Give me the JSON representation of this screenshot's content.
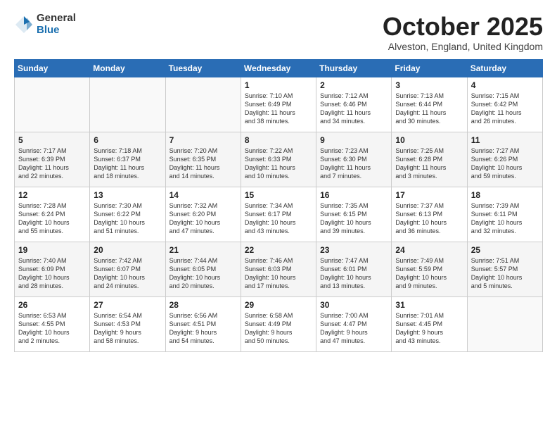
{
  "logo": {
    "general": "General",
    "blue": "Blue"
  },
  "title": "October 2025",
  "location": "Alveston, England, United Kingdom",
  "weekdays": [
    "Sunday",
    "Monday",
    "Tuesday",
    "Wednesday",
    "Thursday",
    "Friday",
    "Saturday"
  ],
  "weeks": [
    [
      {
        "date": "",
        "info": ""
      },
      {
        "date": "",
        "info": ""
      },
      {
        "date": "",
        "info": ""
      },
      {
        "date": "1",
        "info": "Sunrise: 7:10 AM\nSunset: 6:49 PM\nDaylight: 11 hours\nand 38 minutes."
      },
      {
        "date": "2",
        "info": "Sunrise: 7:12 AM\nSunset: 6:46 PM\nDaylight: 11 hours\nand 34 minutes."
      },
      {
        "date": "3",
        "info": "Sunrise: 7:13 AM\nSunset: 6:44 PM\nDaylight: 11 hours\nand 30 minutes."
      },
      {
        "date": "4",
        "info": "Sunrise: 7:15 AM\nSunset: 6:42 PM\nDaylight: 11 hours\nand 26 minutes."
      }
    ],
    [
      {
        "date": "5",
        "info": "Sunrise: 7:17 AM\nSunset: 6:39 PM\nDaylight: 11 hours\nand 22 minutes."
      },
      {
        "date": "6",
        "info": "Sunrise: 7:18 AM\nSunset: 6:37 PM\nDaylight: 11 hours\nand 18 minutes."
      },
      {
        "date": "7",
        "info": "Sunrise: 7:20 AM\nSunset: 6:35 PM\nDaylight: 11 hours\nand 14 minutes."
      },
      {
        "date": "8",
        "info": "Sunrise: 7:22 AM\nSunset: 6:33 PM\nDaylight: 11 hours\nand 10 minutes."
      },
      {
        "date": "9",
        "info": "Sunrise: 7:23 AM\nSunset: 6:30 PM\nDaylight: 11 hours\nand 7 minutes."
      },
      {
        "date": "10",
        "info": "Sunrise: 7:25 AM\nSunset: 6:28 PM\nDaylight: 11 hours\nand 3 minutes."
      },
      {
        "date": "11",
        "info": "Sunrise: 7:27 AM\nSunset: 6:26 PM\nDaylight: 10 hours\nand 59 minutes."
      }
    ],
    [
      {
        "date": "12",
        "info": "Sunrise: 7:28 AM\nSunset: 6:24 PM\nDaylight: 10 hours\nand 55 minutes."
      },
      {
        "date": "13",
        "info": "Sunrise: 7:30 AM\nSunset: 6:22 PM\nDaylight: 10 hours\nand 51 minutes."
      },
      {
        "date": "14",
        "info": "Sunrise: 7:32 AM\nSunset: 6:20 PM\nDaylight: 10 hours\nand 47 minutes."
      },
      {
        "date": "15",
        "info": "Sunrise: 7:34 AM\nSunset: 6:17 PM\nDaylight: 10 hours\nand 43 minutes."
      },
      {
        "date": "16",
        "info": "Sunrise: 7:35 AM\nSunset: 6:15 PM\nDaylight: 10 hours\nand 39 minutes."
      },
      {
        "date": "17",
        "info": "Sunrise: 7:37 AM\nSunset: 6:13 PM\nDaylight: 10 hours\nand 36 minutes."
      },
      {
        "date": "18",
        "info": "Sunrise: 7:39 AM\nSunset: 6:11 PM\nDaylight: 10 hours\nand 32 minutes."
      }
    ],
    [
      {
        "date": "19",
        "info": "Sunrise: 7:40 AM\nSunset: 6:09 PM\nDaylight: 10 hours\nand 28 minutes."
      },
      {
        "date": "20",
        "info": "Sunrise: 7:42 AM\nSunset: 6:07 PM\nDaylight: 10 hours\nand 24 minutes."
      },
      {
        "date": "21",
        "info": "Sunrise: 7:44 AM\nSunset: 6:05 PM\nDaylight: 10 hours\nand 20 minutes."
      },
      {
        "date": "22",
        "info": "Sunrise: 7:46 AM\nSunset: 6:03 PM\nDaylight: 10 hours\nand 17 minutes."
      },
      {
        "date": "23",
        "info": "Sunrise: 7:47 AM\nSunset: 6:01 PM\nDaylight: 10 hours\nand 13 minutes."
      },
      {
        "date": "24",
        "info": "Sunrise: 7:49 AM\nSunset: 5:59 PM\nDaylight: 10 hours\nand 9 minutes."
      },
      {
        "date": "25",
        "info": "Sunrise: 7:51 AM\nSunset: 5:57 PM\nDaylight: 10 hours\nand 5 minutes."
      }
    ],
    [
      {
        "date": "26",
        "info": "Sunrise: 6:53 AM\nSunset: 4:55 PM\nDaylight: 10 hours\nand 2 minutes."
      },
      {
        "date": "27",
        "info": "Sunrise: 6:54 AM\nSunset: 4:53 PM\nDaylight: 9 hours\nand 58 minutes."
      },
      {
        "date": "28",
        "info": "Sunrise: 6:56 AM\nSunset: 4:51 PM\nDaylight: 9 hours\nand 54 minutes."
      },
      {
        "date": "29",
        "info": "Sunrise: 6:58 AM\nSunset: 4:49 PM\nDaylight: 9 hours\nand 50 minutes."
      },
      {
        "date": "30",
        "info": "Sunrise: 7:00 AM\nSunset: 4:47 PM\nDaylight: 9 hours\nand 47 minutes."
      },
      {
        "date": "31",
        "info": "Sunrise: 7:01 AM\nSunset: 4:45 PM\nDaylight: 9 hours\nand 43 minutes."
      },
      {
        "date": "",
        "info": ""
      }
    ]
  ]
}
